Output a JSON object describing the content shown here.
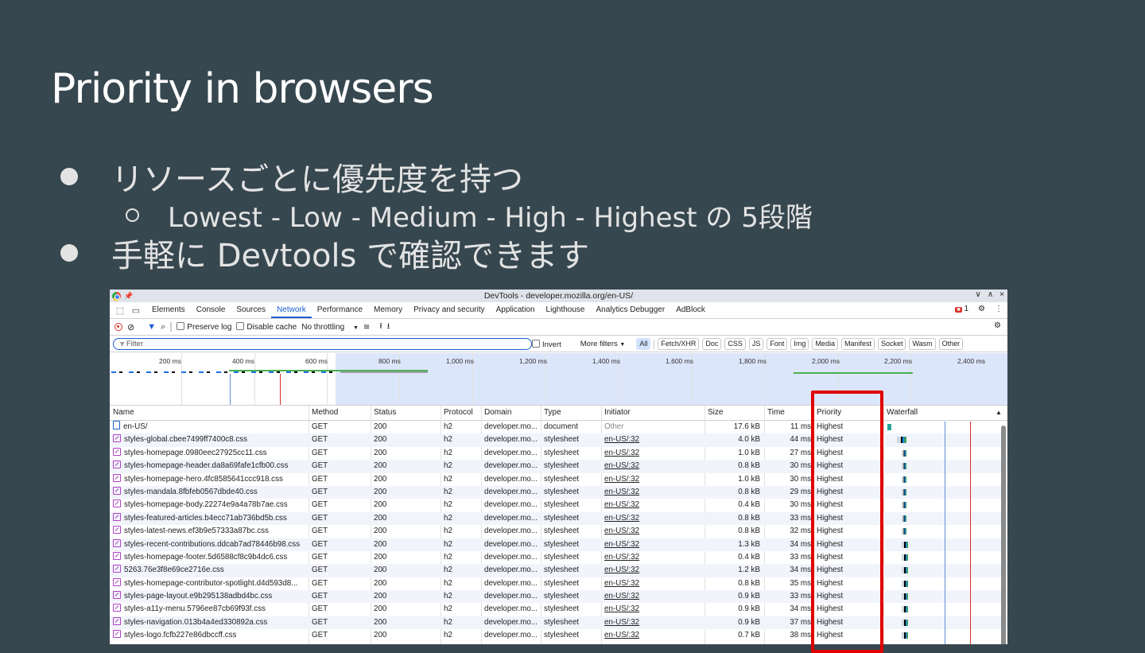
{
  "slide": {
    "title": "Priority in browsers",
    "bullet1": "リソースごとに優先度を持つ",
    "sub1": "Lowest - Low - Medium - High - Highest の 5段階",
    "bullet2": "手軽に Devtools で確認できます"
  },
  "window": {
    "title": "DevTools - developer.mozilla.org/en-US/",
    "controls": [
      "∨",
      "∧",
      "×"
    ]
  },
  "tabs": [
    "Elements",
    "Console",
    "Sources",
    "Network",
    "Performance",
    "Memory",
    "Privacy and security",
    "Application",
    "Lighthouse",
    "Analytics Debugger",
    "AdBlock"
  ],
  "active_tab": "Network",
  "issues_count": "1",
  "toolbar": {
    "preserve_log": "Preserve log",
    "disable_cache": "Disable cache",
    "throttling": "No throttling"
  },
  "filter": {
    "placeholder": "Filter",
    "invert": "Invert",
    "more_filters": "More filters",
    "types": [
      "All",
      "Fetch/XHR",
      "Doc",
      "CSS",
      "JS",
      "Font",
      "Img",
      "Media",
      "Manifest",
      "Socket",
      "Wasm",
      "Other"
    ],
    "selected_type": "All"
  },
  "overview_ticks": [
    "200 ms",
    "400 ms",
    "600 ms",
    "800 ms",
    "1,000 ms",
    "1,200 ms",
    "1,400 ms",
    "1,600 ms",
    "1,800 ms",
    "2,000 ms",
    "2,200 ms",
    "2,400 ms"
  ],
  "columns": [
    "Name",
    "Method",
    "Status",
    "Protocol",
    "Domain",
    "Type",
    "Initiator",
    "Size",
    "Time",
    "Priority",
    "Waterfall"
  ],
  "rows": [
    {
      "name": "en-US/",
      "method": "GET",
      "status": "200",
      "protocol": "h2",
      "domain": "developer.mo...",
      "type": "document",
      "initiator": "Other",
      "size": "17.6 kB",
      "time": "11 ms",
      "priority": "Highest",
      "icon": "document-icon",
      "wf": [
        0.02,
        0.05
      ]
    },
    {
      "name": "styles-global.cbee7499ff7400c8.css",
      "method": "GET",
      "status": "200",
      "protocol": "h2",
      "domain": "developer.mo...",
      "type": "stylesheet",
      "initiator": "en-US/:32",
      "size": "4.0 kB",
      "time": "44 ms",
      "priority": "Highest",
      "icon": "css-icon",
      "wf": [
        0.1,
        0.18
      ]
    },
    {
      "name": "styles-homepage.0980eec27925cc11.css",
      "method": "GET",
      "status": "200",
      "protocol": "h2",
      "domain": "developer.mo...",
      "type": "stylesheet",
      "initiator": "en-US/:32",
      "size": "1.0 kB",
      "time": "27 ms",
      "priority": "Highest",
      "icon": "css-icon",
      "wf": [
        0.14,
        0.18
      ]
    },
    {
      "name": "styles-homepage-header.da8a69fafe1cfb00.css",
      "method": "GET",
      "status": "200",
      "protocol": "h2",
      "domain": "developer.mo...",
      "type": "stylesheet",
      "initiator": "en-US/:32",
      "size": "0.8 kB",
      "time": "30 ms",
      "priority": "Highest",
      "icon": "css-icon",
      "wf": [
        0.14,
        0.18
      ]
    },
    {
      "name": "styles-homepage-hero.4fc8585641ccc918.css",
      "method": "GET",
      "status": "200",
      "protocol": "h2",
      "domain": "developer.mo...",
      "type": "stylesheet",
      "initiator": "en-US/:32",
      "size": "1.0 kB",
      "time": "30 ms",
      "priority": "Highest",
      "icon": "css-icon",
      "wf": [
        0.14,
        0.18
      ]
    },
    {
      "name": "styles-mandala.8fbfeb0567dbde40.css",
      "method": "GET",
      "status": "200",
      "protocol": "h2",
      "domain": "developer.mo...",
      "type": "stylesheet",
      "initiator": "en-US/:32",
      "size": "0.8 kB",
      "time": "29 ms",
      "priority": "Highest",
      "icon": "css-icon",
      "wf": [
        0.14,
        0.18
      ]
    },
    {
      "name": "styles-homepage-body.22274e9a4a78b7ae.css",
      "method": "GET",
      "status": "200",
      "protocol": "h2",
      "domain": "developer.mo...",
      "type": "stylesheet",
      "initiator": "en-US/:32",
      "size": "0.4 kB",
      "time": "30 ms",
      "priority": "Highest",
      "icon": "css-icon",
      "wf": [
        0.14,
        0.18
      ]
    },
    {
      "name": "styles-featured-articles.b4ecc71ab736bd5b.css",
      "method": "GET",
      "status": "200",
      "protocol": "h2",
      "domain": "developer.mo...",
      "type": "stylesheet",
      "initiator": "en-US/:32",
      "size": "0.8 kB",
      "time": "33 ms",
      "priority": "Highest",
      "icon": "css-icon",
      "wf": [
        0.14,
        0.18
      ]
    },
    {
      "name": "styles-latest-news.ef3b9e57333a87bc.css",
      "method": "GET",
      "status": "200",
      "protocol": "h2",
      "domain": "developer.mo...",
      "type": "stylesheet",
      "initiator": "en-US/:32",
      "size": "0.8 kB",
      "time": "32 ms",
      "priority": "Highest",
      "icon": "css-icon",
      "wf": [
        0.14,
        0.18
      ]
    },
    {
      "name": "styles-recent-contributions.ddcab7ad78446b98.css",
      "method": "GET",
      "status": "200",
      "protocol": "h2",
      "domain": "developer.mo...",
      "type": "stylesheet",
      "initiator": "en-US/:32",
      "size": "1.3 kB",
      "time": "34 ms",
      "priority": "Highest",
      "icon": "css-icon",
      "wf": [
        0.14,
        0.19
      ]
    },
    {
      "name": "styles-homepage-footer.5d6588cf8c9b4dc6.css",
      "method": "GET",
      "status": "200",
      "protocol": "h2",
      "domain": "developer.mo...",
      "type": "stylesheet",
      "initiator": "en-US/:32",
      "size": "0.4 kB",
      "time": "33 ms",
      "priority": "Highest",
      "icon": "css-icon",
      "wf": [
        0.14,
        0.19
      ]
    },
    {
      "name": "5263.76e3f8e69ce2716e.css",
      "method": "GET",
      "status": "200",
      "protocol": "h2",
      "domain": "developer.mo...",
      "type": "stylesheet",
      "initiator": "en-US/:32",
      "size": "1.2 kB",
      "time": "34 ms",
      "priority": "Highest",
      "icon": "css-icon",
      "wf": [
        0.14,
        0.19
      ]
    },
    {
      "name": "styles-homepage-contributor-spotlight.d4d593d8...",
      "method": "GET",
      "status": "200",
      "protocol": "h2",
      "domain": "developer.mo...",
      "type": "stylesheet",
      "initiator": "en-US/:32",
      "size": "0.8 kB",
      "time": "35 ms",
      "priority": "Highest",
      "icon": "css-icon",
      "wf": [
        0.14,
        0.19
      ]
    },
    {
      "name": "styles-page-layout.e9b295138adbd4bc.css",
      "method": "GET",
      "status": "200",
      "protocol": "h2",
      "domain": "developer.mo...",
      "type": "stylesheet",
      "initiator": "en-US/:32",
      "size": "0.9 kB",
      "time": "33 ms",
      "priority": "Highest",
      "icon": "css-icon",
      "wf": [
        0.14,
        0.19
      ]
    },
    {
      "name": "styles-a11y-menu.5796ee87cb69f93f.css",
      "method": "GET",
      "status": "200",
      "protocol": "h2",
      "domain": "developer.mo...",
      "type": "stylesheet",
      "initiator": "en-US/:32",
      "size": "0.9 kB",
      "time": "34 ms",
      "priority": "Highest",
      "icon": "css-icon",
      "wf": [
        0.14,
        0.19
      ]
    },
    {
      "name": "styles-navigation.013b4a4ed330892a.css",
      "method": "GET",
      "status": "200",
      "protocol": "h2",
      "domain": "developer.mo...",
      "type": "stylesheet",
      "initiator": "en-US/:32",
      "size": "0.9 kB",
      "time": "37 ms",
      "priority": "Highest",
      "icon": "css-icon",
      "wf": [
        0.14,
        0.19
      ]
    },
    {
      "name": "styles-logo.fcfb227e86dbccff.css",
      "method": "GET",
      "status": "200",
      "protocol": "h2",
      "domain": "developer.mo...",
      "type": "stylesheet",
      "initiator": "en-US/:32",
      "size": "0.7 kB",
      "time": "38 ms",
      "priority": "Highest",
      "icon": "css-icon",
      "wf": [
        0.14,
        0.19
      ]
    }
  ],
  "colors": {
    "background": "#37474f",
    "accent": "#1a5fd0",
    "highlight_box": "#e00000"
  }
}
